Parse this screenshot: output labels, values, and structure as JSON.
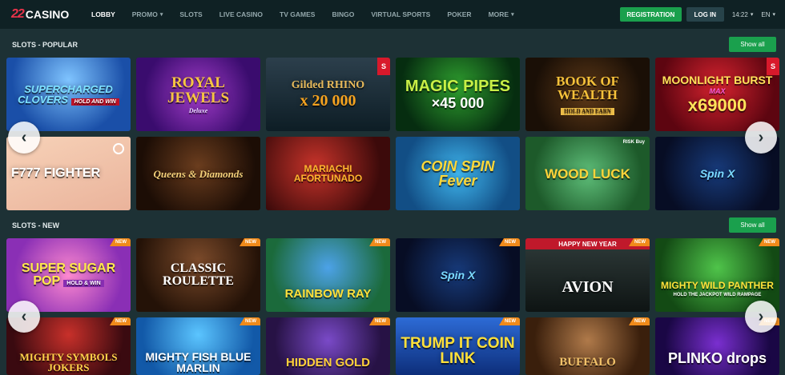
{
  "header": {
    "logo_mark": "22",
    "logo_text": "CASINO",
    "nav": [
      {
        "label": "LOBBY",
        "active": true,
        "dropdown": false
      },
      {
        "label": "PROMO",
        "active": false,
        "dropdown": true
      },
      {
        "label": "SLOTS",
        "active": false,
        "dropdown": false
      },
      {
        "label": "LIVE CASINO",
        "active": false,
        "dropdown": false
      },
      {
        "label": "TV GAMES",
        "active": false,
        "dropdown": false
      },
      {
        "label": "BINGO",
        "active": false,
        "dropdown": false
      },
      {
        "label": "VIRTUAL SPORTS",
        "active": false,
        "dropdown": false
      },
      {
        "label": "POKER",
        "active": false,
        "dropdown": false
      },
      {
        "label": "MORE",
        "active": false,
        "dropdown": true
      }
    ],
    "registration_label": "REGISTRATION",
    "login_label": "LOG IN",
    "time": "14:22",
    "language": "EN"
  },
  "sections": [
    {
      "title": "SLOTS - POPULAR",
      "show_all_label": "Show all",
      "games": [
        {
          "title": "SUPERCHARGED CLOVERS",
          "sub": "HOLD AND WIN"
        },
        {
          "title": "ROYAL JEWELS",
          "sub": "Deluxe"
        },
        {
          "title": "Gilded RHINO",
          "prize": "x 20 000",
          "side_badge": "S"
        },
        {
          "title": "MAGIC PIPES",
          "prize": "×45 000"
        },
        {
          "title": "BOOK OF WEALTH",
          "sub": "HOLD AND EARN"
        },
        {
          "title": "MOONLIGHT BURST",
          "sub": "MAX",
          "prize": "x69000",
          "side_badge": "S"
        },
        {
          "title": "F777 FIGHTER"
        },
        {
          "title": "Queens & Diamonds"
        },
        {
          "title": "MARIACHI AFORTUNADO"
        },
        {
          "title": "COIN SPIN Fever"
        },
        {
          "title": "WOOD LUCK",
          "sub": "RISK Buy"
        },
        {
          "title": "Spin X"
        }
      ]
    },
    {
      "title": "SLOTS - NEW",
      "show_all_label": "Show all",
      "games": [
        {
          "title": "SUPER SUGAR POP",
          "sub": "HOLD & WIN",
          "badge": "NEW"
        },
        {
          "title": "CLASSIC ROULETTE",
          "badge": "NEW"
        },
        {
          "title": "RAINBOW RAY",
          "badge": "NEW"
        },
        {
          "title": "Spin X",
          "badge": "NEW"
        },
        {
          "title": "AVION",
          "sub": "HAPPY NEW YEAR",
          "badge": "NEW"
        },
        {
          "title": "MIGHTY WILD PANTHER",
          "sub": "HOLD THE JACKPOT WILD RAMPAGE",
          "badge": "NEW"
        },
        {
          "title": "MIGHTY SYMBOLS JOKERS",
          "badge": "NEW"
        },
        {
          "title": "MIGHTY FISH BLUE MARLIN",
          "badge": "NEW"
        },
        {
          "title": "HIDDEN GOLD",
          "badge": "NEW"
        },
        {
          "title": "TRUMP IT COIN LINK",
          "badge": "NEW"
        },
        {
          "title": "BUFFALO",
          "badge": "NEW"
        },
        {
          "title": "PLINKO drops",
          "badge": "NEW"
        }
      ]
    }
  ],
  "icons": {
    "prev": "chevron-left-icon",
    "next": "chevron-right-icon",
    "caret": "chevron-down-icon"
  },
  "colors": {
    "accent_green": "#1aa04d",
    "badge_orange": "#f08a1a",
    "topbar_bg": "#0f2124",
    "page_bg": "#1d3135"
  }
}
